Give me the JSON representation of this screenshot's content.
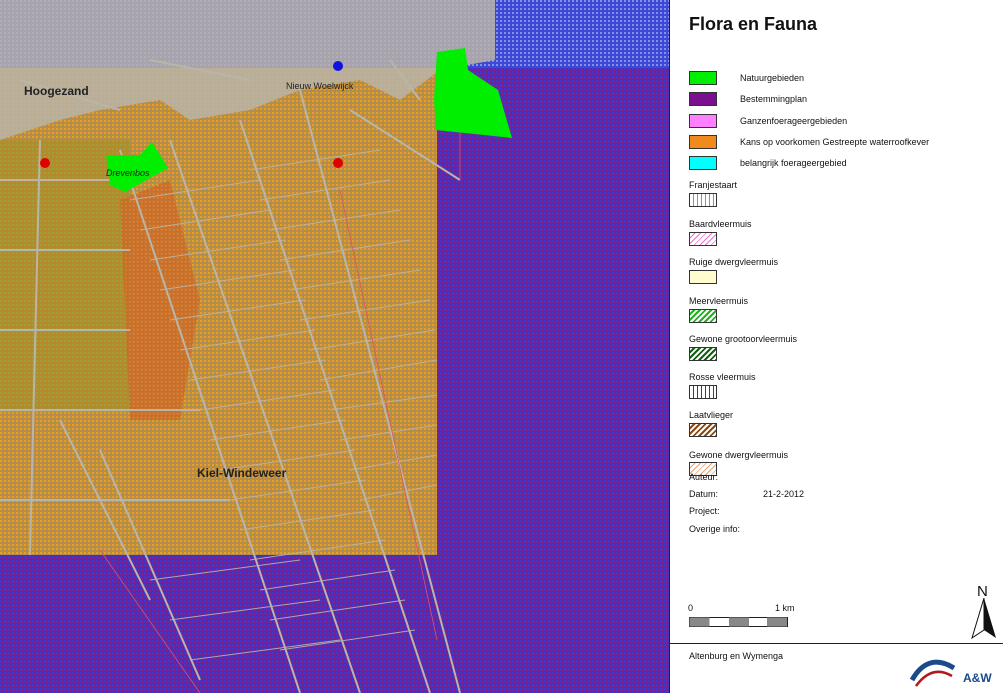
{
  "map": {
    "labels": {
      "hoogezand": "Hoogezand",
      "nieuw_woelwijck": "Nieuw Woelwijck",
      "drevenbos": "Drevenbos",
      "kiel_windeweer": "Kiel-Windeweer"
    },
    "colors": {
      "natuurgebieden": "#00ee00",
      "bestemmingplan": "#7a1090",
      "kans_waterroofkever": "#f08a1c",
      "map_background": "#c98a2a",
      "roads": "#b8b6aa",
      "points": "#e00000",
      "blue_point": "#1010e0"
    }
  },
  "legend": {
    "title": "Flora en Fauna",
    "items": [
      {
        "label": "Natuurgebieden",
        "color": "#00ee00"
      },
      {
        "label": "Bestemmingplan",
        "color": "#7a1090"
      },
      {
        "label": "Ganzenfoerageergebieden",
        "color": "#ff80ff"
      },
      {
        "label": "Kans op voorkomen Gestreepte waterroofkever",
        "color": "#f08a1c"
      },
      {
        "label": "belangrijk foerageergebied",
        "color": "#00ffff"
      }
    ],
    "bats": [
      {
        "label": "Franjestaart",
        "pattern": "vertical-cyan"
      },
      {
        "label": "Baardvleermuis",
        "pattern": "diagonal-pink"
      },
      {
        "label": "Ruige dwergvleermuis",
        "pattern": "solid-cream"
      },
      {
        "label": "Meervleermuis",
        "pattern": "diagonal-green"
      },
      {
        "label": "Gewone grootoorvleermuis",
        "pattern": "diagonal-darkgreen"
      },
      {
        "label": "Rosse vleermuis",
        "pattern": "vertical-red"
      },
      {
        "label": "Laatvlieger",
        "pattern": "diagonal-brown"
      },
      {
        "label": "Gewone dwergvleermuis",
        "pattern": "diagonal-peach"
      }
    ]
  },
  "meta": {
    "auteur_label": "Auteur:",
    "datum_label": "Datum:",
    "datum_value": "21-2-2012",
    "project_label": "Project:",
    "overige_label": "Overige info:"
  },
  "scale": {
    "start": "0",
    "end": "1 km"
  },
  "north": "N",
  "footer": {
    "company": "Altenburg en Wymenga",
    "logo_text": "A&W"
  }
}
